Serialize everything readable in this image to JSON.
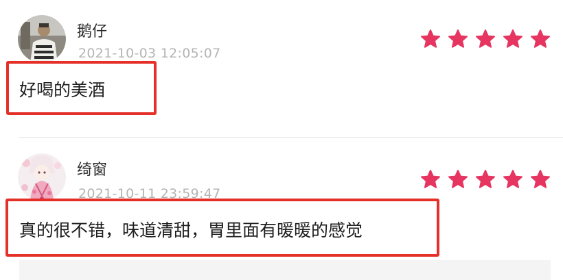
{
  "reviews": [
    {
      "username": "鹅仔",
      "timestamp": "2021-10-03 12:05:07",
      "rating": 5,
      "max_rating": 5,
      "comment": "好喝的美酒",
      "avatar": "user-photo-avatar"
    },
    {
      "username": "绮窗",
      "timestamp": "2021-10-11 23:59:47",
      "rating": 5,
      "max_rating": 5,
      "comment": "真的很不错，味道清甜，胃里面有暖暖的感觉",
      "avatar": "anime-illustration-avatar"
    }
  ],
  "colors": {
    "star": "#e63560",
    "highlight_border": "#e5302a",
    "timestamp": "#b4b4b4",
    "divider": "#e3e3e3"
  },
  "icons": {
    "star": "star-icon"
  }
}
